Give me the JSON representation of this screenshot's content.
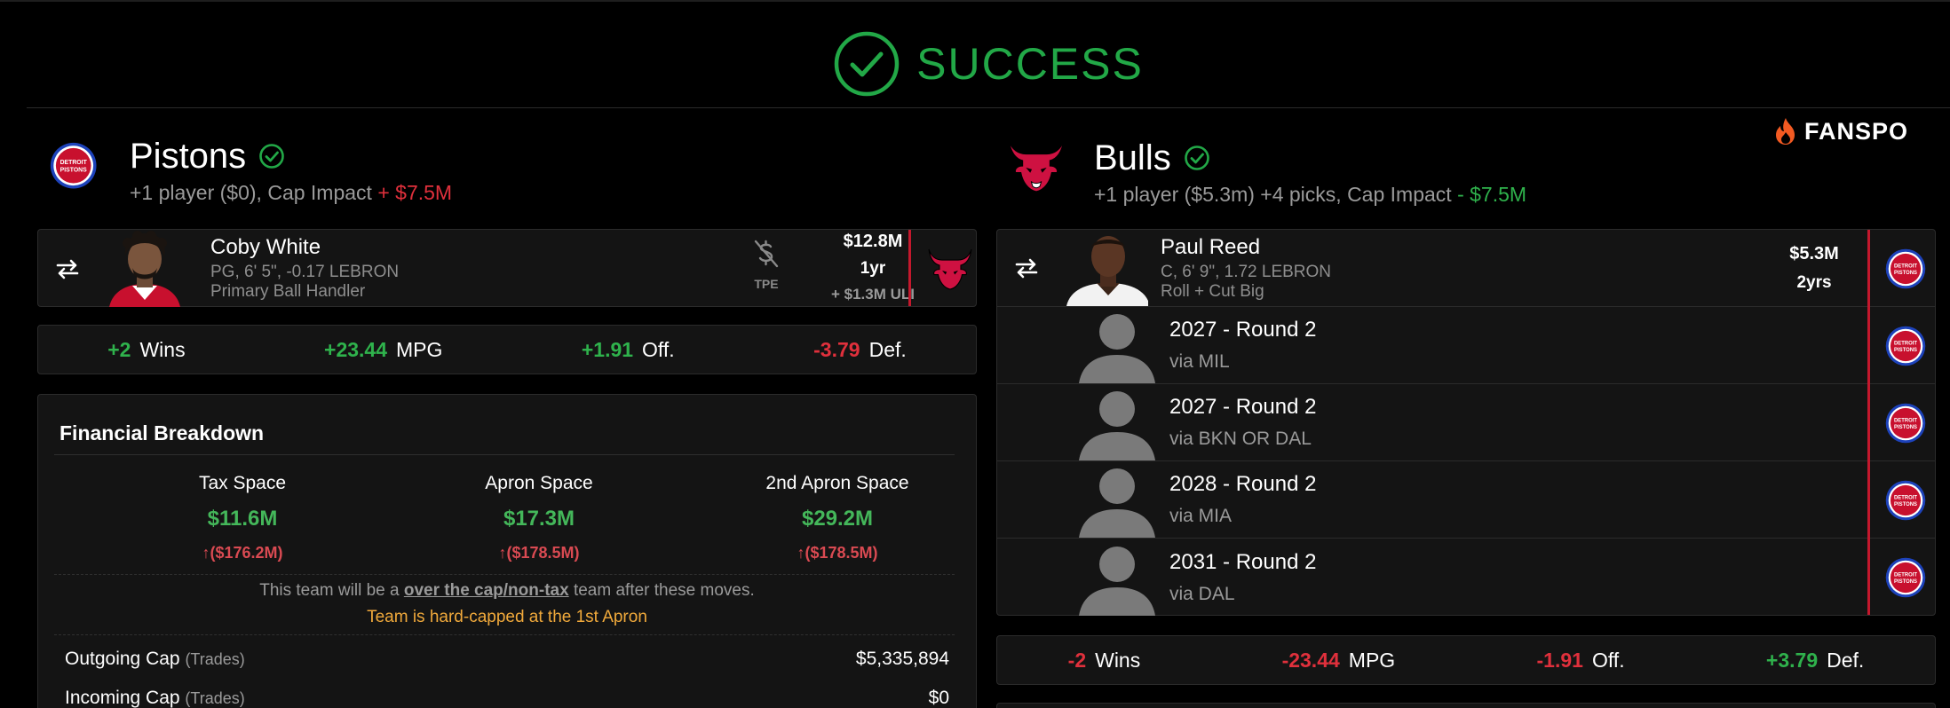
{
  "banner": {
    "status": "SUCCESS"
  },
  "brand": {
    "name": "FANSPO"
  },
  "colors": {
    "success": "#22a847",
    "negative": "#e0303c",
    "positive": "#2fb24c",
    "warning": "#f0a93b",
    "team_stripe": "#c4182d"
  },
  "left": {
    "team_name": "Pistons",
    "sub_prefix": "+1 player ($0), Cap Impact",
    "sub_impact": "+ $7.5M",
    "logo_text": [
      "DETROIT",
      "PISTONS"
    ],
    "player": {
      "name": "Coby White",
      "meta": "PG, 6' 5\", -0.17 LEBRON",
      "role": "Primary Ball Handler",
      "tpe_label": "TPE",
      "salary": "$12.8M",
      "years": "1yr",
      "extra": "+ $1.3M ULI",
      "icons": [
        "swap-icon",
        "no-dollar-icon",
        "bulls-logo"
      ]
    },
    "stats": [
      {
        "value": "+2",
        "label": "Wins",
        "tone": "positive"
      },
      {
        "value": "+23.44",
        "label": "MPG",
        "tone": "positive"
      },
      {
        "value": "+1.91",
        "label": "Off.",
        "tone": "positive"
      },
      {
        "value": "-3.79",
        "label": "Def.",
        "tone": "negative"
      }
    ],
    "finance": {
      "title": "Financial Breakdown",
      "columns": [
        {
          "label": "Tax Space",
          "value": "$11.6M",
          "delta": "($176.2M)"
        },
        {
          "label": "Apron Space",
          "value": "$17.3M",
          "delta": "($178.5M)"
        },
        {
          "label": "2nd Apron Space",
          "value": "$29.2M",
          "delta": "($178.5M)"
        }
      ],
      "note_prefix": "This team will be a",
      "note_link": "over the cap/non-tax",
      "note_suffix": "team after these moves.",
      "warning": "Team is hard-capped at the 1st Apron",
      "outgoing_label": "Outgoing Cap",
      "outgoing_sub": "(Trades)",
      "outgoing_value": "$5,335,894",
      "incoming_label": "Incoming Cap",
      "incoming_sub": "(Trades)",
      "incoming_value": "$0"
    }
  },
  "right": {
    "team_name": "Bulls",
    "sub_prefix": "+1 player ($5.3m) +4 picks, Cap Impact",
    "sub_impact": "- $7.5M",
    "player": {
      "name": "Paul Reed",
      "meta": "C, 6' 9\", 1.72 LEBRON",
      "role": "Roll + Cut Big",
      "salary": "$5.3M",
      "years": "2yrs"
    },
    "picks": [
      {
        "title": "2027 - Round 2",
        "via": "via MIL"
      },
      {
        "title": "2027 - Round 2",
        "via": "via BKN OR DAL"
      },
      {
        "title": "2028 - Round 2",
        "via": "via MIA"
      },
      {
        "title": "2031 - Round 2",
        "via": "via DAL"
      }
    ],
    "stats": [
      {
        "value": "-2",
        "label": "Wins",
        "tone": "negative"
      },
      {
        "value": "-23.44",
        "label": "MPG",
        "tone": "negative"
      },
      {
        "value": "-1.91",
        "label": "Off.",
        "tone": "negative"
      },
      {
        "value": "+3.79",
        "label": "Def.",
        "tone": "positive"
      }
    ]
  }
}
